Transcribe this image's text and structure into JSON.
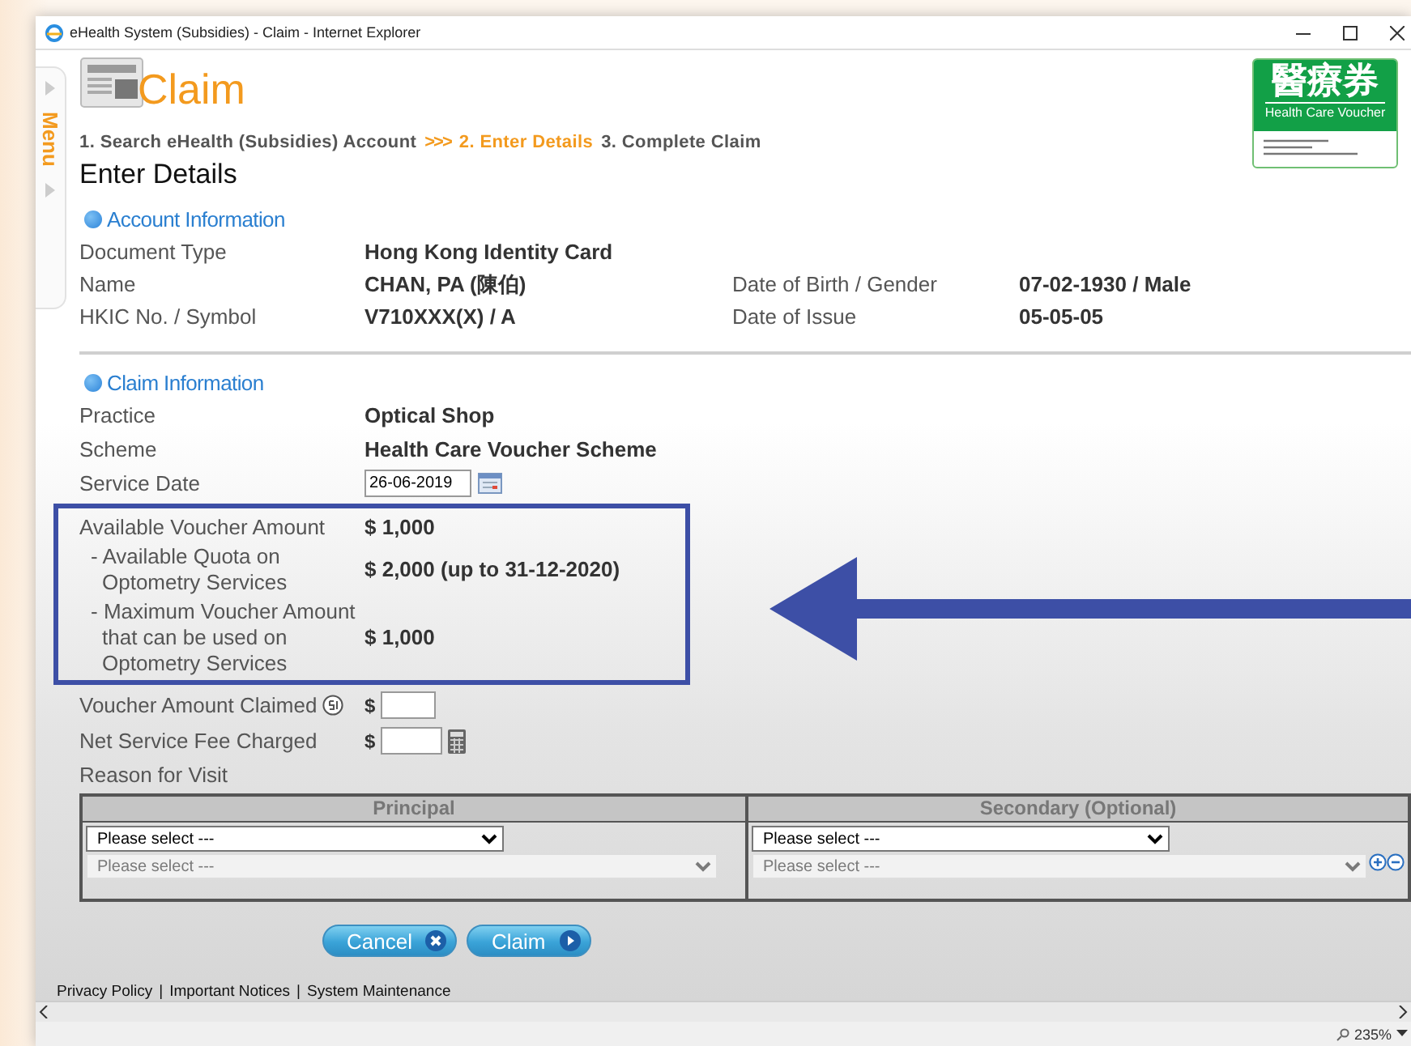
{
  "window": {
    "title": "eHealth System (Subsidies) - Claim - Internet Explorer"
  },
  "menu_tab": {
    "label": "Menu"
  },
  "page": {
    "title": "Claim",
    "steps": [
      {
        "label": "1. Search eHealth (Subsidies) Account",
        "selected": false
      },
      {
        "label": "2. Enter Details",
        "selected": true
      },
      {
        "label": "3. Complete Claim",
        "selected": false
      }
    ],
    "step_separator": ">>>",
    "heading": "Enter Details"
  },
  "logo": {
    "title": "醫療券",
    "subtitle": "Health Care Voucher"
  },
  "account_information": {
    "title": "Account Information",
    "rows": [
      {
        "label": "Document Type",
        "value": "Hong Kong Identity Card"
      },
      {
        "label": "Name",
        "value": "CHAN, PA (陳伯)",
        "extra_label": "Date of Birth / Gender",
        "extra_value": "07-02-1930 / Male"
      },
      {
        "label": "HKIC No. / Symbol",
        "value": "V710XXX(X) / A",
        "extra_label": "Date of Issue",
        "extra_value": "05-05-05"
      }
    ]
  },
  "claim_information": {
    "title": "Claim Information",
    "rows": [
      {
        "label": "Practice",
        "value": "Optical Shop"
      },
      {
        "label": "Scheme",
        "value": "Health Care Voucher Scheme"
      }
    ],
    "service_date": {
      "label": "Service Date",
      "value": "26-06-2019"
    },
    "highlighted_rows": [
      {
        "label": "Available Voucher Amount",
        "value": "$ 1,000",
        "sub": false
      },
      {
        "label": "- Available Quota on Optometry Services",
        "value": "$ 2,000 (up to 31-12-2020)",
        "sub": true
      },
      {
        "label": "- Maximum Voucher Amount that can be used on Optometry Services",
        "value": "$ 1,000",
        "sub": true
      }
    ],
    "voucher_claimed": {
      "label": "Voucher Amount Claimed",
      "currency": "$"
    },
    "net_fee": {
      "label": "Net Service Fee Charged",
      "currency": "$"
    },
    "reason": {
      "label": "Reason for Visit",
      "columns": [
        {
          "title": "Principal",
          "selects": [
            {
              "value": "Please select ---",
              "disabled": false
            },
            {
              "value": "Please select ---",
              "disabled": true
            }
          ]
        },
        {
          "title": "Secondary (Optional)",
          "selects": [
            {
              "value": "Please select ---",
              "disabled": false
            },
            {
              "value": "Please select ---",
              "disabled": true
            }
          ]
        }
      ]
    }
  },
  "buttons": [
    {
      "label": "Cancel",
      "kind": "cancel"
    },
    {
      "label": "Claim",
      "kind": "next"
    }
  ],
  "footer": {
    "links": [
      "Privacy Policy",
      "Important Notices",
      "System Maintenance"
    ],
    "separator": "|"
  },
  "status_bar": {
    "zoom": "235%"
  }
}
